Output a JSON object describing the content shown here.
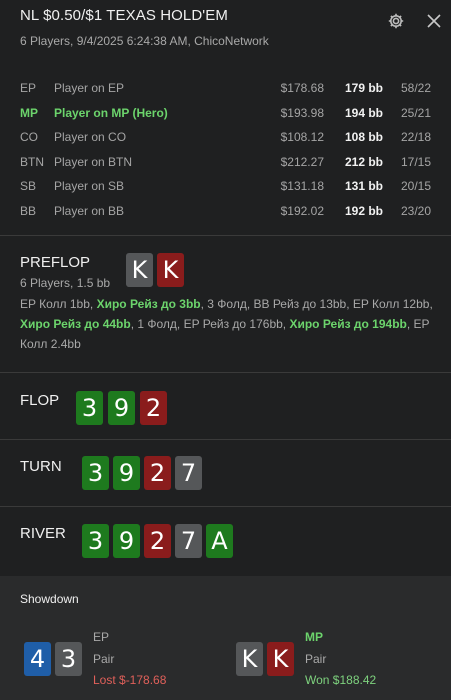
{
  "header": {
    "title": "NL $0.50/$1 TEXAS HOLD'EM",
    "subtitle": "6 Players, 9/4/2025 6:24:38 AM, ChicoNetwork"
  },
  "players": [
    {
      "pos": "EP",
      "name": "Player on EP",
      "stack": "$178.68",
      "bb": "179 bb",
      "stat": "58/22",
      "hero": false
    },
    {
      "pos": "MP",
      "name": "Player on MP (Hero)",
      "stack": "$193.98",
      "bb": "194 bb",
      "stat": "25/21",
      "hero": true
    },
    {
      "pos": "CO",
      "name": "Player on CO",
      "stack": "$108.12",
      "bb": "108 bb",
      "stat": "22/18",
      "hero": false
    },
    {
      "pos": "BTN",
      "name": "Player on BTN",
      "stack": "$212.27",
      "bb": "212 bb",
      "stat": "17/15",
      "hero": false
    },
    {
      "pos": "SB",
      "name": "Player on SB",
      "stack": "$131.18",
      "bb": "131 bb",
      "stat": "20/15",
      "hero": false
    },
    {
      "pos": "BB",
      "name": "Player on BB",
      "stack": "$192.02",
      "bb": "192 bb",
      "stat": "23/20",
      "hero": false
    }
  ],
  "preflop": {
    "label": "PREFLOP",
    "info": "6 Players, 1.5 bb",
    "cards": [
      {
        "rank": "K",
        "color": "gray"
      },
      {
        "rank": "K",
        "color": "red"
      }
    ],
    "actions": [
      {
        "text": "EP Колл 1bb, ",
        "hero": false
      },
      {
        "text": "Хиро Рейз до 3bb",
        "hero": true
      },
      {
        "text": ", 3 Фолд, BB Рейз до 13bb, EP Колл 12bb, ",
        "hero": false
      },
      {
        "text": "Хиро Рейз до 44bb",
        "hero": true
      },
      {
        "text": ", 1 Фолд, EP Рейз до 176bb, ",
        "hero": false
      },
      {
        "text": "Хиро Рейз до 194bb",
        "hero": true
      },
      {
        "text": ", EP Колл 2.4bb",
        "hero": false
      }
    ]
  },
  "flop": {
    "label": "FLOP",
    "cards": [
      {
        "rank": "3",
        "color": "green"
      },
      {
        "rank": "9",
        "color": "green"
      },
      {
        "rank": "2",
        "color": "red"
      }
    ]
  },
  "turn": {
    "label": "TURN",
    "cards": [
      {
        "rank": "3",
        "color": "green"
      },
      {
        "rank": "9",
        "color": "green"
      },
      {
        "rank": "2",
        "color": "red"
      },
      {
        "rank": "7",
        "color": "gray"
      }
    ]
  },
  "river": {
    "label": "RIVER",
    "cards": [
      {
        "rank": "3",
        "color": "green"
      },
      {
        "rank": "9",
        "color": "green"
      },
      {
        "rank": "2",
        "color": "red"
      },
      {
        "rank": "7",
        "color": "gray"
      },
      {
        "rank": "A",
        "color": "green"
      }
    ]
  },
  "showdown": {
    "title": "Showdown",
    "hands": [
      {
        "cards": [
          {
            "rank": "4",
            "color": "blue"
          },
          {
            "rank": "3",
            "color": "gray"
          }
        ],
        "pos": "EP",
        "hand": "Pair",
        "result": "Lost $-178.68",
        "result_color": "#e0605a",
        "pos_color": "#a9a9a9"
      },
      {
        "cards": [
          {
            "rank": "K",
            "color": "gray"
          },
          {
            "rank": "K",
            "color": "red"
          }
        ],
        "pos": "MP",
        "hand": "Pair",
        "result": "Won $188.42",
        "result_color": "#7ed27e",
        "pos_color": "#6cd46c"
      }
    ]
  },
  "icons": {
    "settings": "gear-icon",
    "close": "close-icon"
  },
  "colors": {
    "background": "#1f2021",
    "hero": "#6cd46c",
    "card_green": "#1e7a1e",
    "card_red": "#8a1c1c",
    "card_gray": "#555759",
    "card_blue": "#1f5ea8"
  }
}
